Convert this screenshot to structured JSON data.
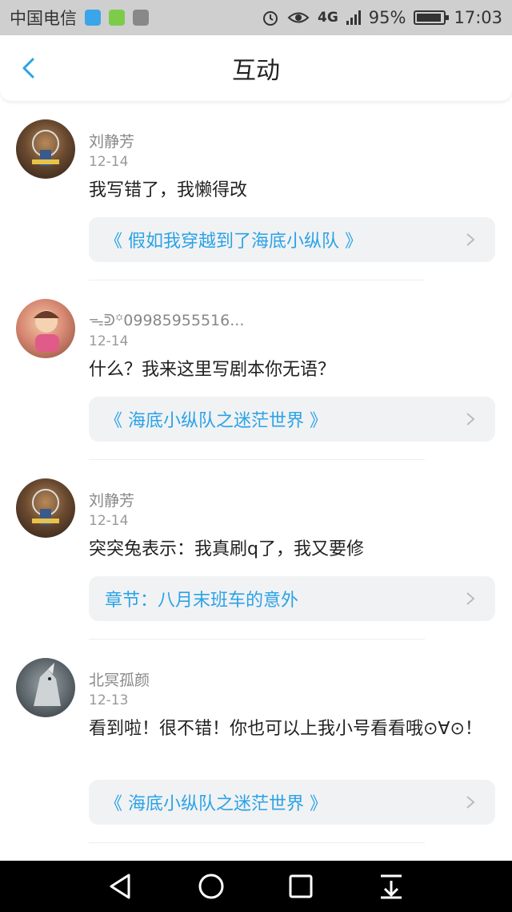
{
  "status_bar": {
    "carrier": "中国电信",
    "network": "4G",
    "network_small": "4G 2G",
    "battery": "95%",
    "time": "17:03",
    "icons": [
      "app-blue-icon",
      "app-green-icon",
      "gallery-icon",
      "alarm-icon",
      "eye-icon",
      "signal-icon",
      "battery-icon"
    ]
  },
  "header": {
    "title": "互动",
    "back_icon": "back-chevron-icon",
    "accent_color": "#2aa3e6"
  },
  "items": [
    {
      "name": "刘静芳",
      "date": "12-14",
      "content": "我写错了，我懒得改",
      "ref": "《 假如我穿越到了海底小纵队 》",
      "avatar_icon": "avatar-photo"
    },
    {
      "name": "ᯓᕲ꙳09985955516...",
      "date": "12-14",
      "content": "什么？我来这里写剧本你无语？",
      "ref": "《 海底小纵队之迷茫世界 》",
      "avatar_icon": "avatar-cartoon"
    },
    {
      "name": "刘静芳",
      "date": "12-14",
      "content": "突突兔表示：我真刷q了，我又要修",
      "ref": "章节：八月末班车的意外",
      "avatar_icon": "avatar-photo"
    },
    {
      "name": "北冥孤颜",
      "date": "12-13",
      "content": "看到啦！很不错！你也可以上我小号看看哦⊙∀⊙！",
      "ref": "《 海底小纵队之迷茫世界 》",
      "avatar_icon": "avatar-wolf"
    }
  ],
  "nav_bar": {
    "icons": [
      "back-triangle-icon",
      "home-circle-icon",
      "recents-square-icon",
      "notification-pull-icon"
    ]
  }
}
